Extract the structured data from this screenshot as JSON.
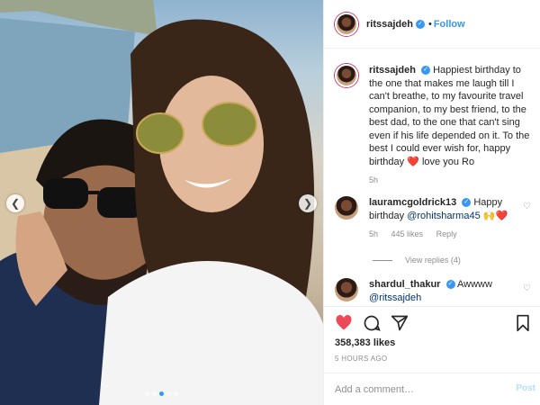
{
  "header": {
    "username": "ritssajdeh",
    "separator": "•",
    "follow_label": "Follow"
  },
  "caption": {
    "username": "ritssajdeh",
    "text": "Happiest birthday to the one that makes me laugh till I can't breathe, to my favourite travel companion, to my best friend, to the best dad, to the one that can't sing even if his life depended on it. To the best I could ever wish for, happy birthday",
    "emoji": "❤️",
    "text_end": "love you Ro",
    "time": "5h"
  },
  "comments": [
    {
      "username": "lauramcgoldrick13",
      "text": "Happy birthday",
      "mention": "@rohitsharma45",
      "emoji": "🙌❤️",
      "time": "5h",
      "likes": "445 likes",
      "reply_label": "Reply",
      "view_replies": "View replies (4)"
    },
    {
      "username": "shardul_thakur",
      "text": "Awwww",
      "mention": "@ritssajdeh"
    }
  ],
  "actions": {
    "likes": "358,383 likes",
    "time_ago": "5 HOURS AGO"
  },
  "add_comment": {
    "placeholder": "Add a comment…",
    "post_label": "Post"
  },
  "carousel": {
    "slide_count": 5,
    "active_index": 2
  },
  "colors": {
    "accent": "#3897f0",
    "heart": "#ed4956",
    "muted": "#8e8e8e"
  },
  "icons": [
    "chevron-left-icon",
    "chevron-right-icon",
    "verified-icon",
    "heart-icon",
    "comment-icon",
    "share-icon",
    "bookmark-icon"
  ]
}
